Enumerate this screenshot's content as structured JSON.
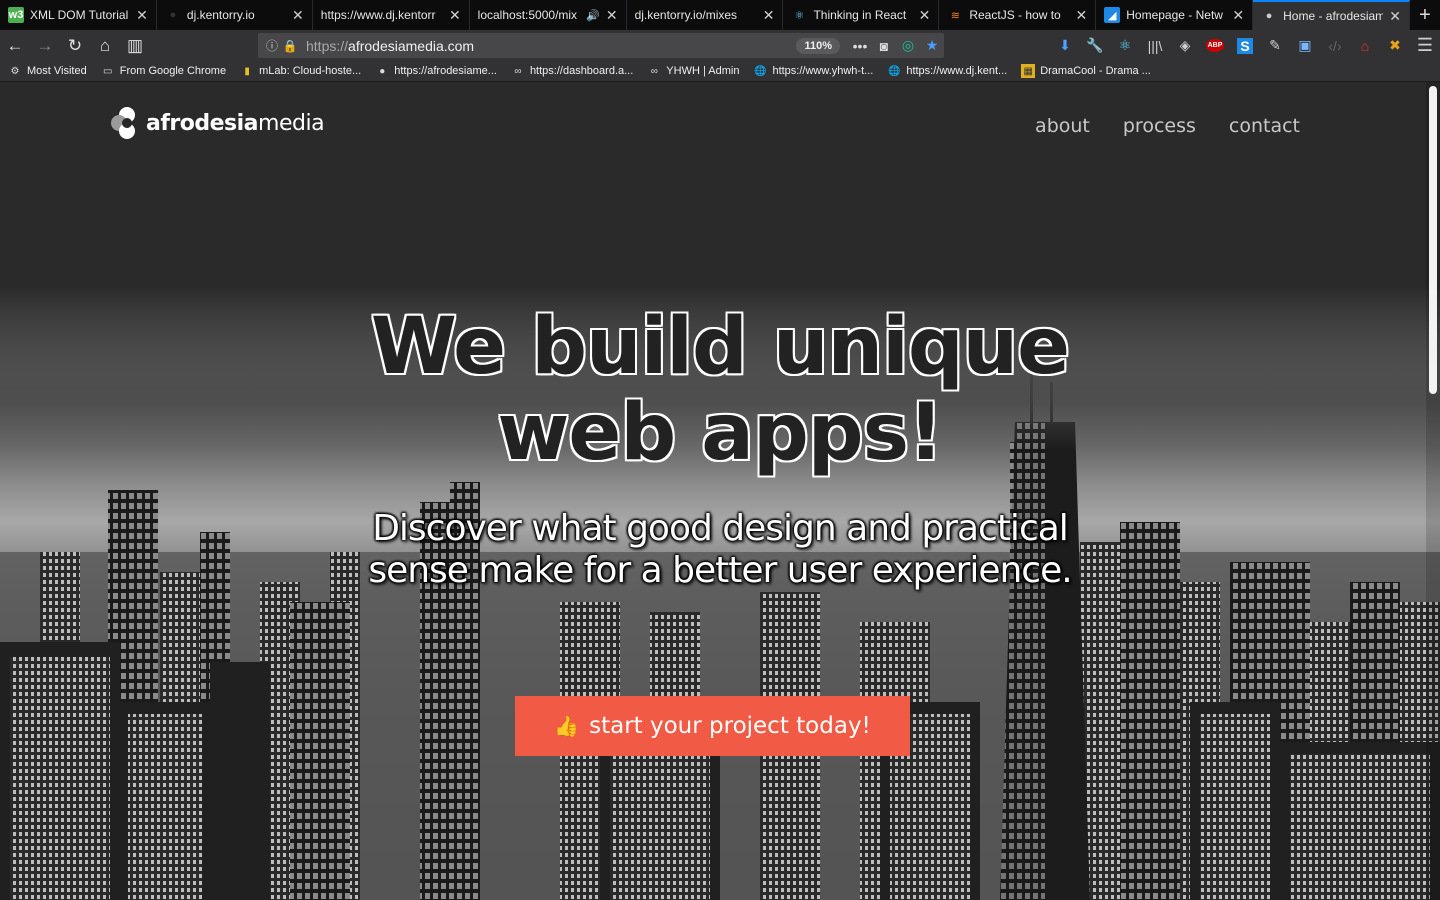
{
  "browser": {
    "tabs": [
      {
        "title": "XML DOM Tutorial",
        "icon": "w3schools-icon",
        "active": false
      },
      {
        "title": "dj.kentorry.io",
        "icon": "site-icon",
        "active": false
      },
      {
        "title": "https://www.dj.kentorr",
        "icon": "none",
        "active": false
      },
      {
        "title": "localhost:5000/mix",
        "icon": "none",
        "active": false,
        "audio": true
      },
      {
        "title": "dj.kentorry.io/mixes",
        "icon": "none",
        "active": false
      },
      {
        "title": "Thinking in React",
        "icon": "react-icon",
        "active": false
      },
      {
        "title": "ReactJS - how to",
        "icon": "stackoverflow-icon",
        "active": false
      },
      {
        "title": "Homepage - Netw",
        "icon": "azure-icon",
        "active": false
      },
      {
        "title": "Home - afrodesiam",
        "icon": "afrodesia-icon",
        "active": true
      }
    ],
    "url": {
      "protocol": "https://",
      "host": "afrodesiamedia.com"
    },
    "zoom": "110%",
    "bookmarks": [
      {
        "label": "Most Visited",
        "icon": "gear-icon"
      },
      {
        "label": "From Google Chrome",
        "icon": "folder-icon"
      },
      {
        "label": "mLab: Cloud-hoste...",
        "icon": "mlab-icon"
      },
      {
        "label": "https://afrodesiame...",
        "icon": "afrodesia-icon"
      },
      {
        "label": "https://dashboard.a...",
        "icon": "link-icon"
      },
      {
        "label": "YHWH | Admin",
        "icon": "link-icon"
      },
      {
        "label": "https://www.yhwh-t...",
        "icon": "globe-icon"
      },
      {
        "label": "https://www.dj.kent...",
        "icon": "globe-icon"
      },
      {
        "label": "DramaCool - Drama ...",
        "icon": "dramacool-icon"
      }
    ]
  },
  "site": {
    "logo": {
      "part1": "afrodesia",
      "part2": "media"
    },
    "nav": [
      "about",
      "process",
      "contact"
    ],
    "hero": {
      "title_line1": "We build unique",
      "title_line2": "web apps!",
      "subtitle": "Discover what good design and practical sense make for a better user experience."
    },
    "cta": {
      "label": "start your project today!",
      "icon": "thumbs-up-icon",
      "color": "#f15a44"
    }
  }
}
